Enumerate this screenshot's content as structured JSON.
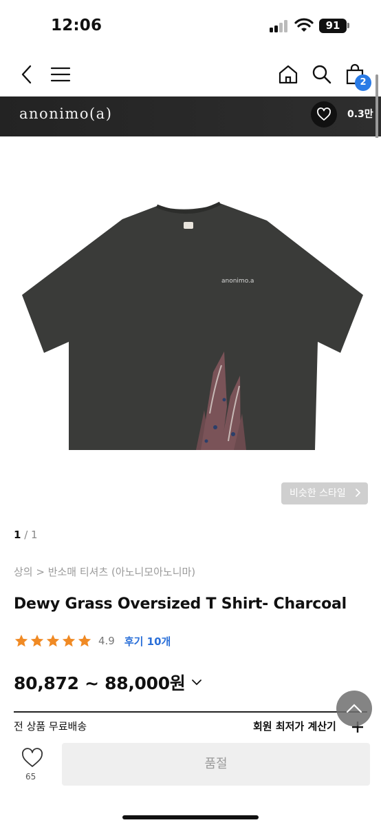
{
  "status_bar": {
    "time": "12:06",
    "battery": "91"
  },
  "nav": {
    "cart_count": "2"
  },
  "brand": {
    "name": "anonimo(a)",
    "likes": "0.3만"
  },
  "product": {
    "similar_style_label": "비슷한 스타일",
    "pager_current": "1",
    "pager_total": "/ 1",
    "breadcrumb": "상의 > 반소매 티셔츠 (아노니모아노니마)",
    "title": "Dewy Grass Oversized T Shirt- Charcoal",
    "rating": "4.9",
    "review_link": "후기 10개",
    "price": "80,872 ~ 88,000원",
    "shipping": "전 상품 무료배송",
    "member_price_label": "회원 최저가 계산기",
    "shirt_print": "anonimo.a"
  },
  "bottom": {
    "like_count": "65",
    "soldout_label": "품절"
  },
  "colors": {
    "accent_blue": "#2a7be6",
    "star": "#f08a24",
    "brand_bar": "#2a2a2a",
    "shirt": "#3a3b39"
  }
}
